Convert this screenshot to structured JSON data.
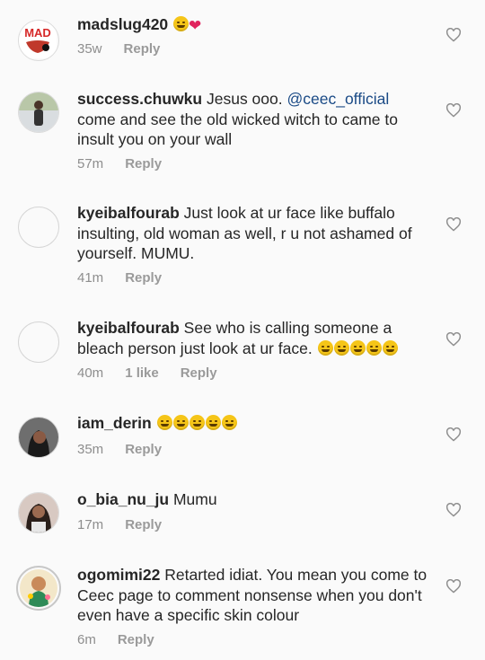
{
  "comments": [
    {
      "username": "madslug420",
      "text": "",
      "emojis": [
        "smiling-face-with-sunglasses-icon",
        "red-heart-icon"
      ],
      "time": "35w",
      "likes": "",
      "reply_label": "Reply",
      "avatar_text": "MAD"
    },
    {
      "username": "success.chuwku",
      "text_before": "Jesus ooo. ",
      "mention": "@ceec_official",
      "text_after": " come and see the old wicked witch to came to insult you on your wall",
      "time": "57m",
      "reply_label": "Reply"
    },
    {
      "username": "kyeibalfourab",
      "text": "Just look at ur face like buffalo insulting, old woman as well, r u not ashamed of yourself. MUMU.",
      "time": "41m",
      "reply_label": "Reply"
    },
    {
      "username": "kyeibalfourab",
      "text": "See who is calling someone a bleach person just look at ur face.",
      "emojis": [
        "pensive-face-icon",
        "pensive-face-icon",
        "rolling-laughing-face-icon",
        "rolling-laughing-face-icon",
        "rolling-laughing-face-icon"
      ],
      "time": "40m",
      "likes": "1 like",
      "reply_label": "Reply"
    },
    {
      "username": "iam_derin",
      "text": "",
      "emojis": [
        "grinning-squinting-face-icon",
        "grinning-squinting-face-icon",
        "grinning-squinting-face-icon",
        "grinning-squinting-face-icon",
        "grinning-squinting-face-icon"
      ],
      "time": "35m",
      "reply_label": "Reply"
    },
    {
      "username": "o_bia_nu_ju",
      "text": "Mumu",
      "time": "17m",
      "reply_label": "Reply"
    },
    {
      "username": "ogomimi22",
      "text": "Retarted idiat. You mean you come to Ceec page to comment nonsense when you don't even have a specific skin colour",
      "time": "6m",
      "reply_label": "Reply"
    }
  ],
  "colors": {
    "background": "#fafafa",
    "text": "#262626",
    "meta": "#8e8e8e",
    "mention": "#1a4a86",
    "heart_outline": "#8e8e8e"
  }
}
